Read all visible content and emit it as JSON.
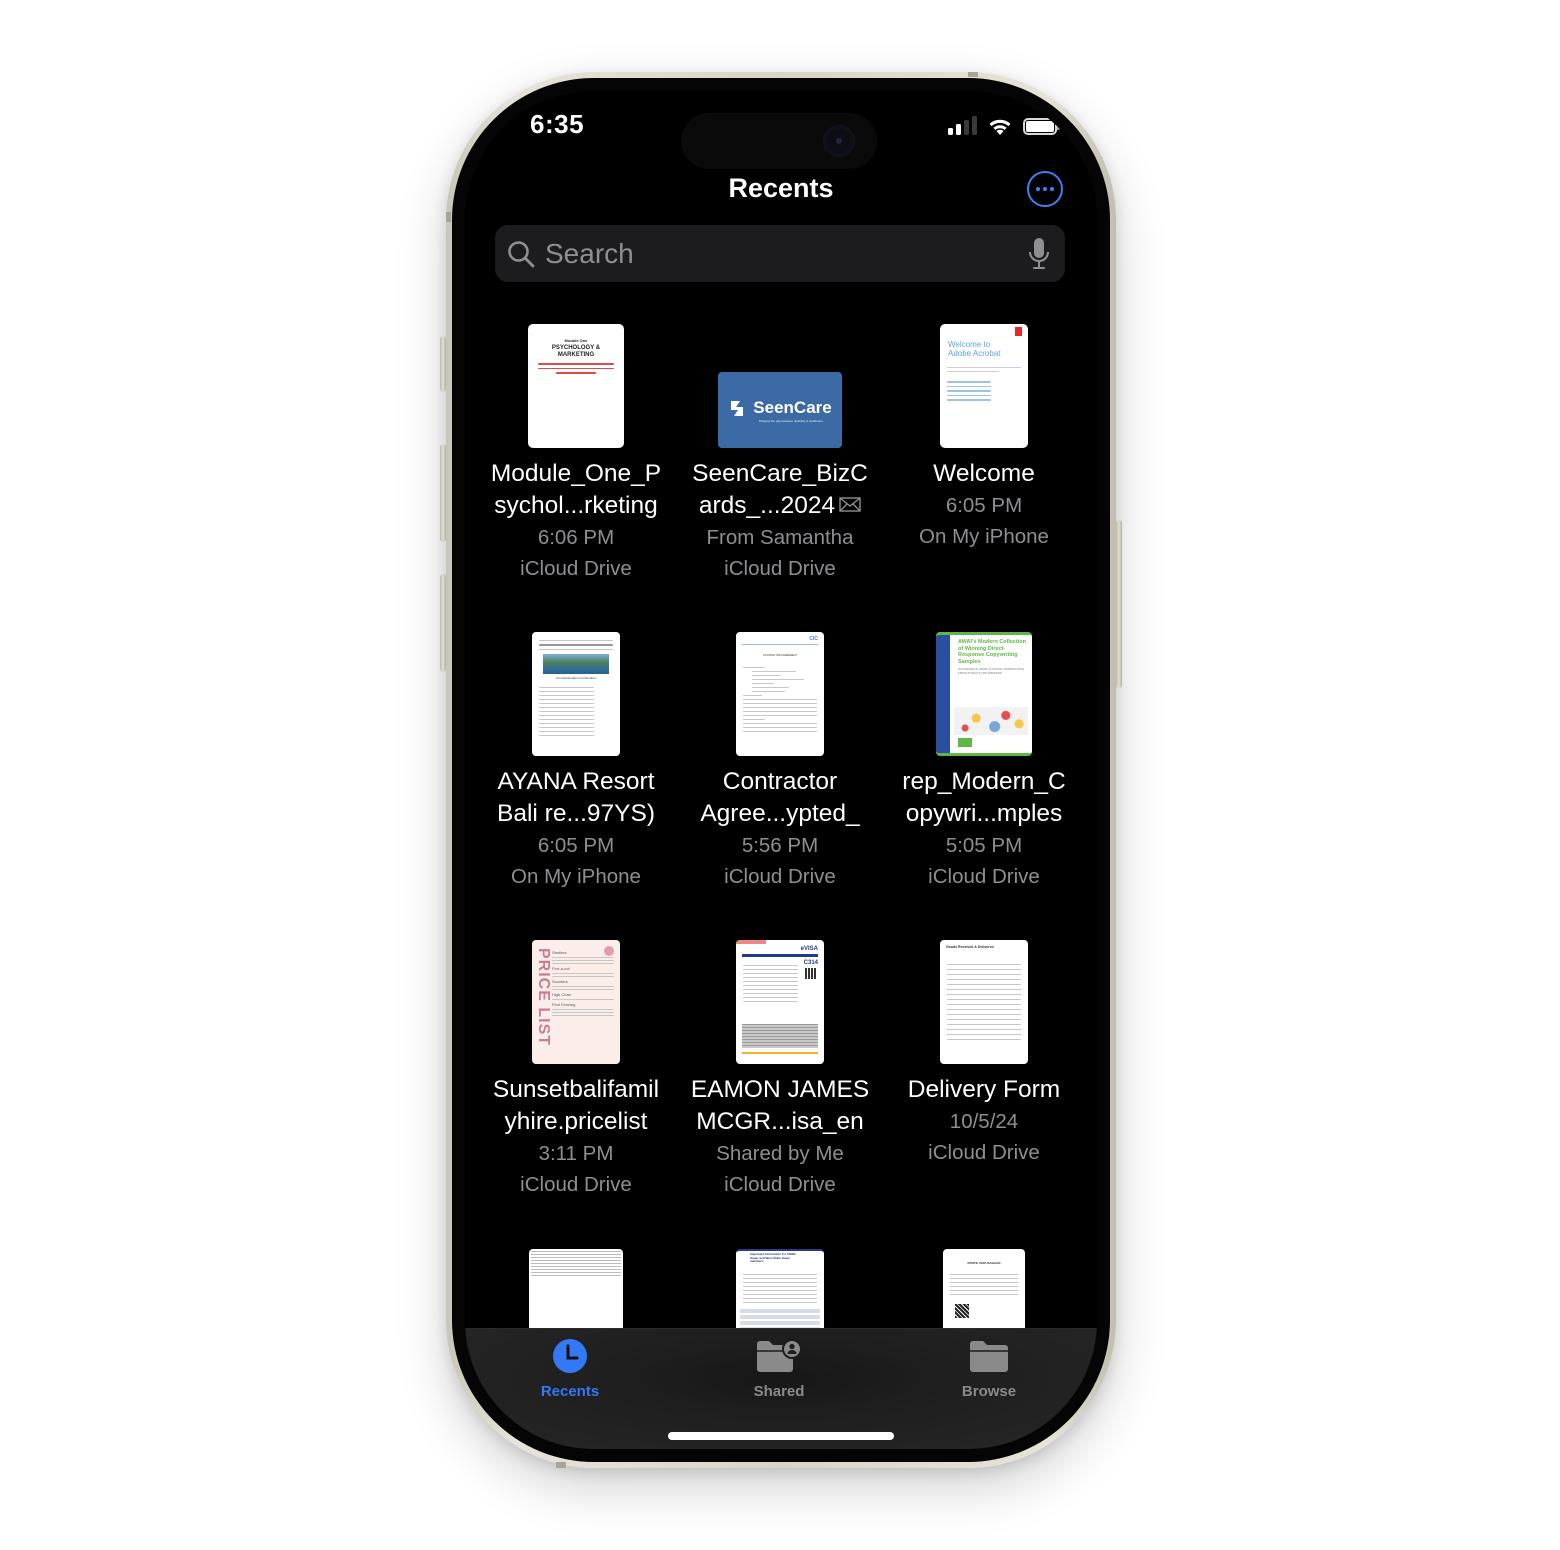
{
  "status_bar": {
    "time": "6:35",
    "signal_bars_active": 2,
    "signal_bars_total": 4,
    "wifi": "wifi-icon",
    "battery": "battery-full-icon"
  },
  "header": {
    "title": "Recents",
    "more_button": "ellipsis-circle-icon"
  },
  "search": {
    "placeholder": "Search",
    "value": "",
    "icon": "magnifier-icon",
    "mic_icon": "microphone-icon"
  },
  "files": [
    {
      "name_line1": "Module_One_P",
      "name_line2": "sychol...rketing",
      "date": "6:06 PM",
      "location": "iCloud Drive",
      "thumb_title": "PSYCHOLOGY & MARKETING",
      "thumb_kicker": "Module One",
      "thumb_type": "document"
    },
    {
      "name_line1": "SeenCare_BizC",
      "name_line2": "ards_...2024",
      "shared_icon": "envelope-icon",
      "sender": "From Samantha",
      "location": "iCloud Drive",
      "thumb_title": "SeenCare",
      "thumb_tagline": "Bridging the gap between disability & healthcare",
      "thumb_type": "business-card"
    },
    {
      "name_line1": "Welcome",
      "date": "6:05 PM",
      "location": "On My iPhone",
      "thumb_title": "Welcome to Adobe Acrobat",
      "thumb_type": "document"
    },
    {
      "name_line1": "AYANA Resort",
      "name_line2": "Bali re...97YS)",
      "date": "6:05 PM",
      "location": "On My iPhone",
      "thumb_title": "Your Reservation Confirmation",
      "thumb_type": "email"
    },
    {
      "name_line1": "Contractor",
      "name_line2": "Agree...ypted_",
      "date": "5:56 PM",
      "location": "iCloud Drive",
      "thumb_title": "CONTRACTOR AGREEMENT",
      "thumb_type": "document"
    },
    {
      "name_line1": "rep_Modern_C",
      "name_line2": "opywri...mples",
      "date": "5:05 PM",
      "location": "iCloud Drive",
      "thumb_title": "AWAI's Modern Collection of Winning Direct-Response Copywriting Samples",
      "thumb_subtitle": "SUCCESSFUL PRINT & DIGITAL PROMOTIONS FROM TODAY'S TOP WRITERS",
      "thumb_type": "book-cover"
    },
    {
      "name_line1": "Sunsetbalifamil",
      "name_line2": "yhire.pricelist",
      "date": "3:11 PM",
      "location": "iCloud Drive",
      "thumb_title": "PRICE LIST",
      "thumb_sections": [
        "Strollers",
        "Port-a-cot",
        "Scooters",
        "High Chair",
        "Pool Fencing"
      ],
      "thumb_type": "price-list"
    },
    {
      "name_line1": "EAMON JAMES",
      "name_line2": "MCGR...isa_en",
      "sender": "Shared by Me",
      "location": "iCloud Drive",
      "thumb_title": "eVISA",
      "thumb_code": "C314",
      "thumb_type": "visa"
    },
    {
      "name_line1": "Delivery Form",
      "date": "10/5/24",
      "location": "iCloud Drive",
      "thumb_title": "Goods Received & Delivered",
      "thumb_type": "form"
    },
    {
      "thumb_type": "spreadsheet"
    },
    {
      "thumb_title": "Important information for CSOB Super and West State Super members",
      "thumb_type": "document"
    },
    {
      "thumb_title": "PROFIL PERUSAHAAN",
      "thumb_type": "document"
    }
  ],
  "tabbar": {
    "active": "Recents",
    "active_color": "#3478f6",
    "inactive_color": "#8a8a8a",
    "tabs": [
      {
        "label": "Recents",
        "icon": "clock-icon"
      },
      {
        "label": "Shared",
        "icon": "shared-folder-icon"
      },
      {
        "label": "Browse",
        "icon": "folder-icon"
      }
    ]
  }
}
